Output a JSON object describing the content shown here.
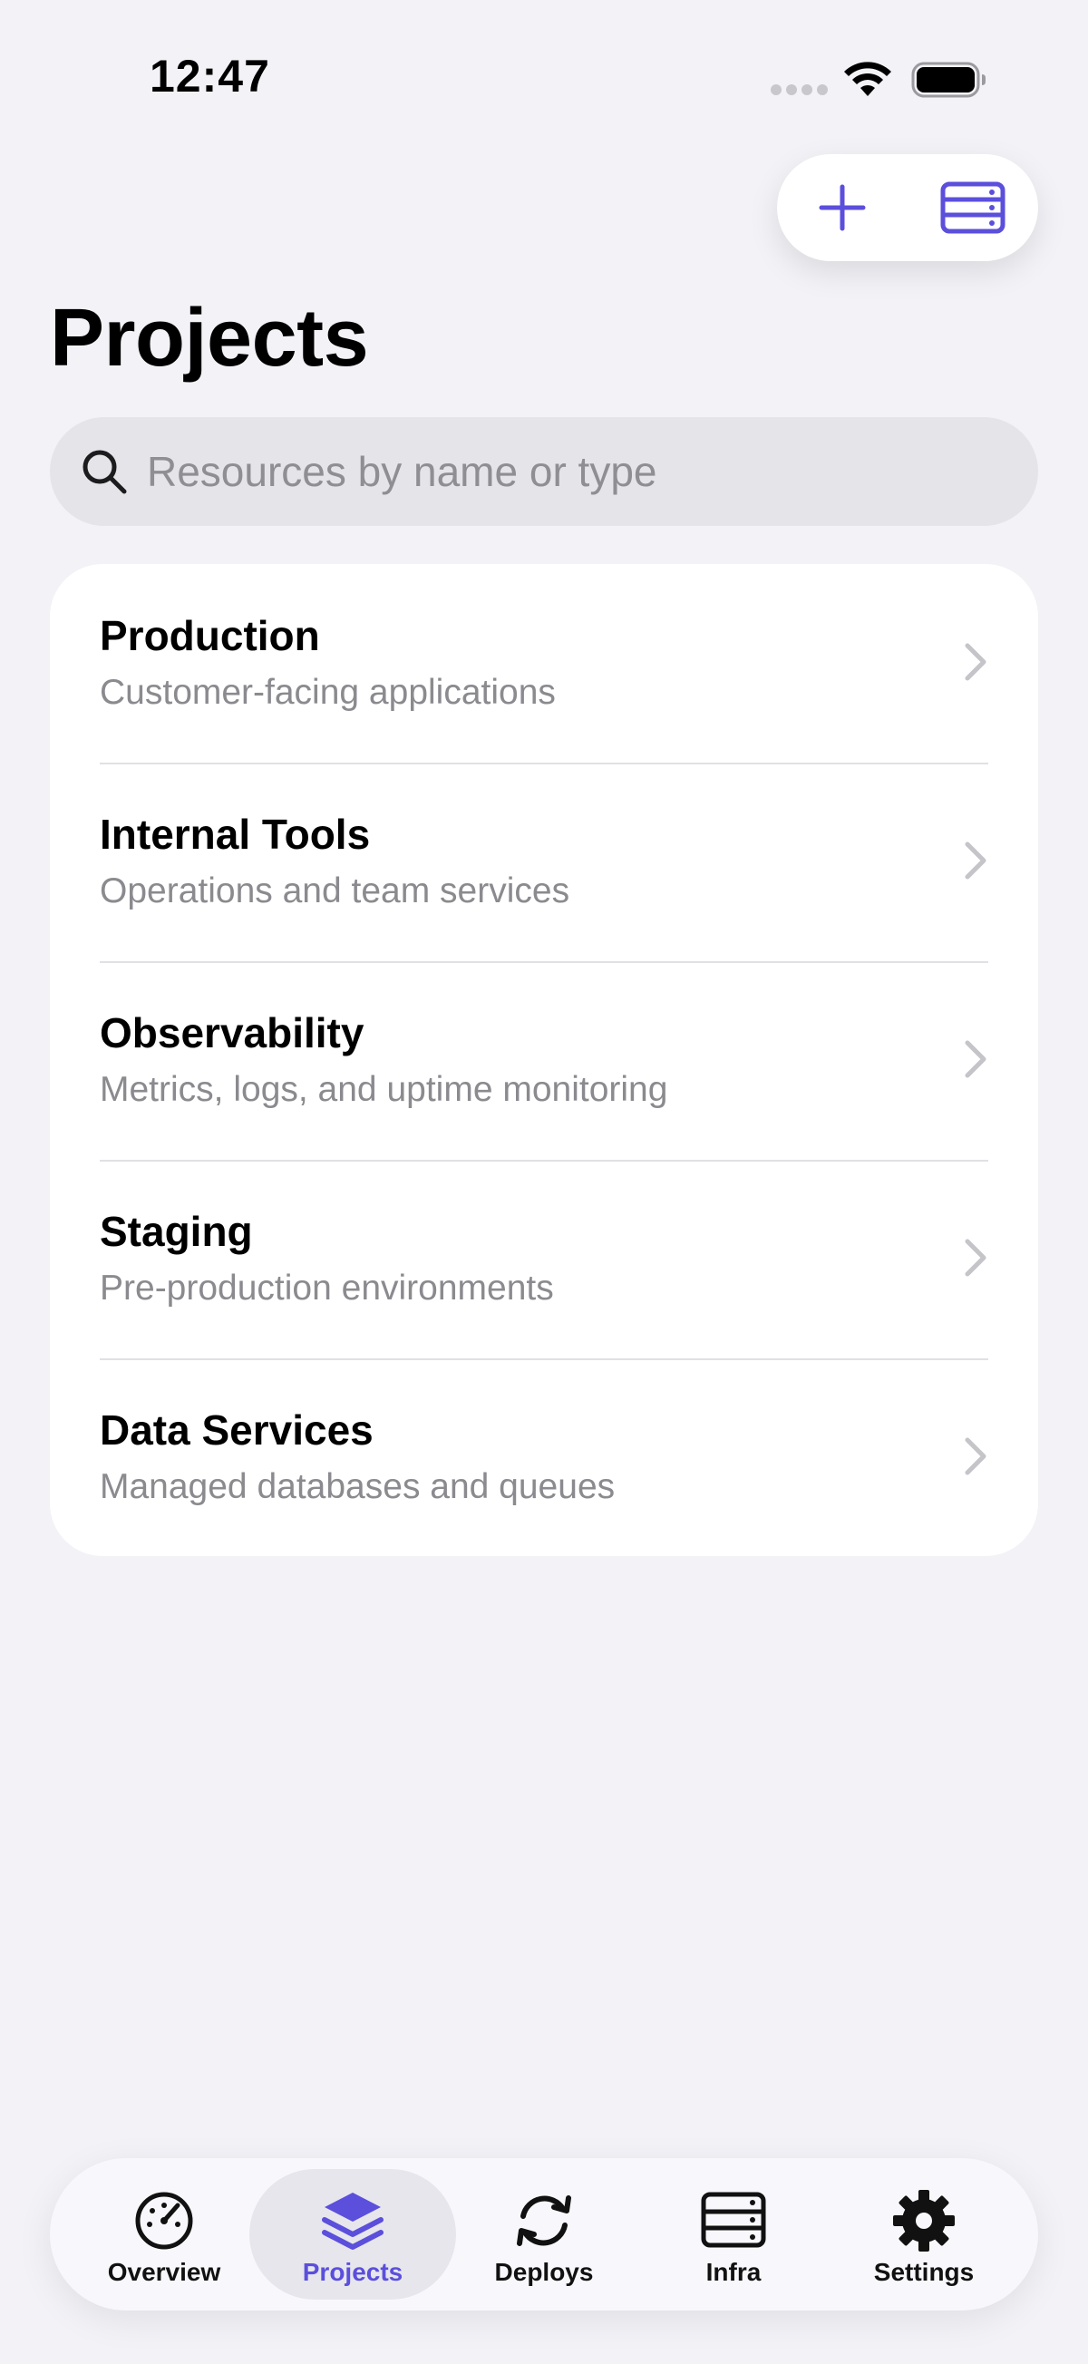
{
  "status_bar": {
    "time": "12:47"
  },
  "colors": {
    "accent": "#5b4fdc",
    "background": "#f2f2f7",
    "card": "#ffffff",
    "secondary_text": "#8a8a8f"
  },
  "actions": {
    "add_icon": "plus-icon",
    "server_icon": "server-icon"
  },
  "page": {
    "title": "Projects"
  },
  "search": {
    "placeholder": "Resources by name or type",
    "value": ""
  },
  "projects": [
    {
      "title": "Production",
      "subtitle": "Customer-facing applications"
    },
    {
      "title": "Internal Tools",
      "subtitle": "Operations and team services"
    },
    {
      "title": "Observability",
      "subtitle": "Metrics, logs, and uptime monitoring"
    },
    {
      "title": "Staging",
      "subtitle": "Pre-production environments"
    },
    {
      "title": "Data Services",
      "subtitle": "Managed databases and queues"
    }
  ],
  "tab_bar": {
    "selected": "Projects",
    "tabs": [
      {
        "label": "Overview",
        "icon": "gauge-icon"
      },
      {
        "label": "Projects",
        "icon": "stack-icon"
      },
      {
        "label": "Deploys",
        "icon": "refresh-icon"
      },
      {
        "label": "Infra",
        "icon": "server-icon"
      },
      {
        "label": "Settings",
        "icon": "gear-icon"
      }
    ]
  }
}
